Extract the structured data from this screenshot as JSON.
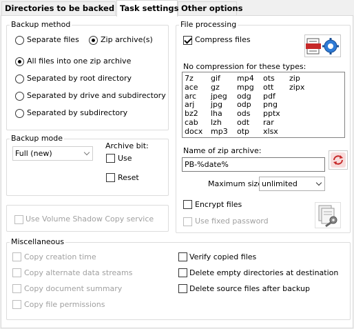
{
  "tabs": [
    {
      "label": "Directories to be backed up"
    },
    {
      "label": "Task settings"
    },
    {
      "label": "Other options"
    }
  ],
  "backup_method": {
    "title": "Backup method",
    "separate_files": "Separate files",
    "zip_archives": "Zip archive(s)",
    "options": [
      "All files into one zip archive",
      "Separated by root directory",
      "Separated by drive and subdirectory",
      "Separated by subdirectory"
    ]
  },
  "backup_mode": {
    "title": "Backup mode",
    "selected": "Full (new)",
    "archive_bit_label": "Archive bit:",
    "use_label": "Use",
    "reset_label": "Reset"
  },
  "vss": {
    "label": "Use Volume Shadow Copy service"
  },
  "file_processing": {
    "title": "File processing",
    "compress_label": "Compress files",
    "no_compression_label": "No compression for these types:",
    "types_columns": [
      [
        "7z",
        "ace",
        "arc",
        "arj",
        "bz2",
        "cab",
        "docx"
      ],
      [
        "gif",
        "gz",
        "jpeg",
        "jpg",
        "lha",
        "lzh",
        "mp3"
      ],
      [
        "mp4",
        "mpg",
        "odg",
        "odp",
        "ods",
        "odt",
        "otp"
      ],
      [
        "ots",
        "ott",
        "pdf",
        "png",
        "pptx",
        "rar",
        "xlsx"
      ],
      [
        "zip",
        "zipx"
      ]
    ],
    "zip_name_label": "Name of zip archive:",
    "zip_name_value": "PB-%date%",
    "max_size_label": "Maximum size:",
    "max_size_value": "unlimited",
    "encrypt_label": "Encrypt files",
    "fixed_password_label": "Use fixed password"
  },
  "misc": {
    "title": "Miscellaneous",
    "left": [
      "Copy creation time",
      "Copy alternate data streams",
      "Copy document summary",
      "Copy file permissions"
    ],
    "right": [
      "Verify copied files",
      "Delete empty directories at destination",
      "Delete source files after backup"
    ]
  }
}
